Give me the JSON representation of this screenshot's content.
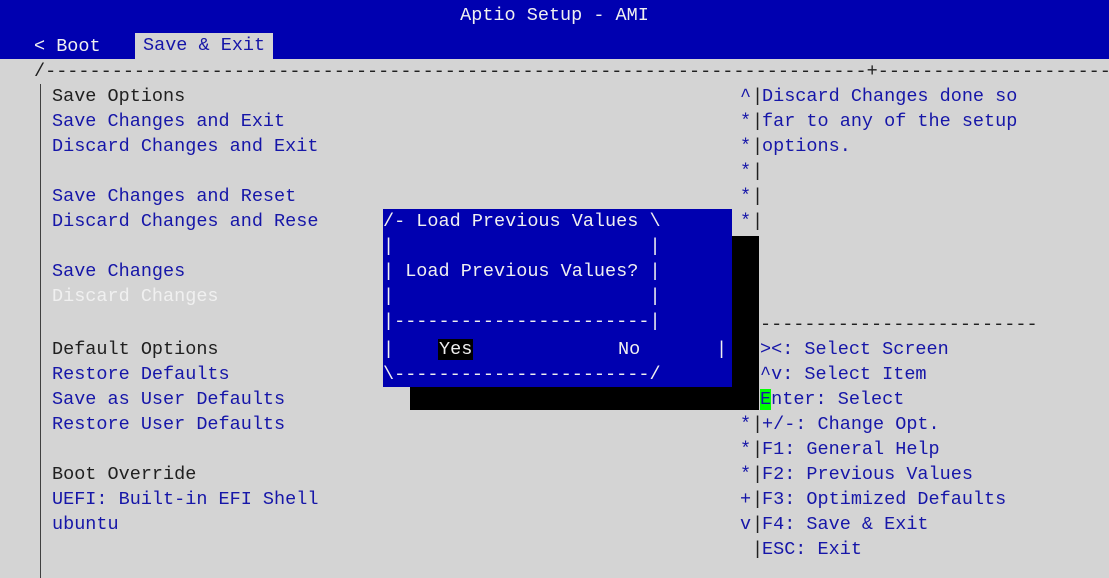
{
  "header": {
    "title": "Aptio Setup - AMI",
    "tabs": [
      {
        "label": "< Boot"
      },
      {
        "label": "Save & Exit"
      }
    ]
  },
  "borders": {
    "top_left": "/--------------------------------------------------------------------------+------------------------",
    "bottom": "\\",
    "help_divider": "-------------------------"
  },
  "menu": {
    "items": [
      {
        "label": "Save Options"
      },
      {
        "label": "Save Changes and Exit"
      },
      {
        "label": "Discard Changes and Exit"
      },
      {
        "label": "Save Changes and Reset"
      },
      {
        "label": "Discard Changes and Rese"
      },
      {
        "label": "Save Changes"
      },
      {
        "label": "Discard Changes"
      },
      {
        "label": "Default Options"
      },
      {
        "label": "Restore Defaults"
      },
      {
        "label": "Save as User Defaults"
      },
      {
        "label": "Restore User Defaults"
      },
      {
        "label": "Boot Override"
      },
      {
        "label": "UEFI: Built-in EFI Shell"
      },
      {
        "label": "ubuntu"
      }
    ]
  },
  "help": {
    "lines": [
      "Discard Changes done so",
      "far to any of the setup",
      "options."
    ]
  },
  "scroll": {
    "markers": [
      "^",
      "*",
      "*",
      "*",
      "*",
      "*",
      "*",
      "*",
      "*",
      "+",
      "v"
    ]
  },
  "keys": {
    "lines": [
      "><: Select Screen",
      "^v: Select Item",
      "Enter: Select",
      "+/-: Change Opt.",
      "F1: General Help",
      "F2: Previous Values",
      "F3: Optimized Defaults",
      "F4: Save & Exit",
      "ESC: Exit"
    ],
    "enter_hl": "E",
    "enter_rest": "nter: Select"
  },
  "dialog": {
    "title_line": "/- Load Previous Values \\",
    "blank1": "|                       |",
    "question_line": "| Load Previous Values? |",
    "blank2": "|                       |",
    "divider": "|-----------------------|",
    "yes": "Yes",
    "no": "No",
    "left_bar": "|",
    "right_bar": "|",
    "bottom_line": "\\-----------------------/"
  },
  "colors": {
    "background": "#d4d4d4",
    "header_bg": "#0000b0",
    "text_blue": "#1616a8",
    "highlight_green": "#00ff00"
  }
}
